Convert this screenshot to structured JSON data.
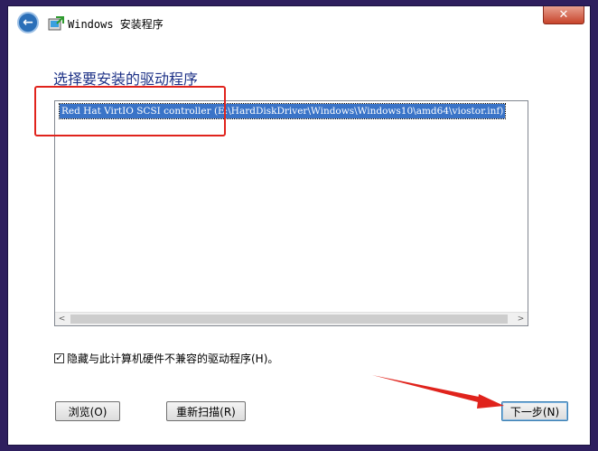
{
  "window": {
    "title": "Windows 安装程序",
    "close_label": "✕"
  },
  "main": {
    "heading": "选择要安装的驱动程序",
    "drivers": [
      "Red Hat VirtIO SCSI controller (E:\\HardDiskDriver\\Windows\\Windows10\\amd64\\viostor.inf)"
    ],
    "scroll_left": "<",
    "scroll_right": ">"
  },
  "options": {
    "hide_incompatible_label": "隐藏与此计算机硬件不兼容的驱动程序(H)。",
    "hide_incompatible_checked": true,
    "checkmark": "✓"
  },
  "buttons": {
    "browse": "浏览(O)",
    "rescan": "重新扫描(R)",
    "next": "下一步(N)"
  },
  "annotation": {
    "color": "#e0231c"
  },
  "colors": {
    "heading": "#1e3287",
    "selection": "#3a74c8",
    "background": "#2e1f5e"
  }
}
